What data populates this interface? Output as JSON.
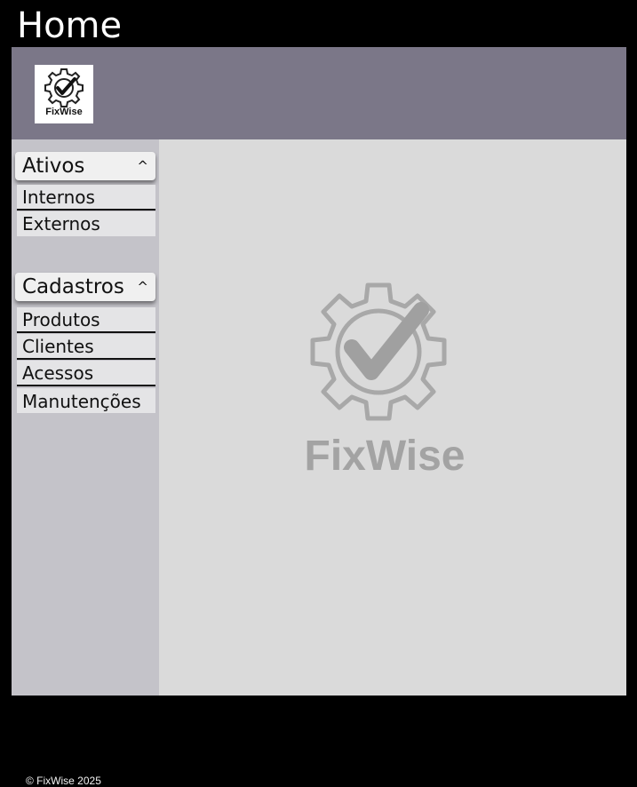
{
  "window": {
    "title": "Home"
  },
  "header": {
    "logo_text": "FixWise",
    "logo_icon": "gear-check-icon"
  },
  "sidebar": {
    "sections": [
      {
        "label": "Ativos",
        "caret": "^",
        "items": [
          {
            "label": "Internos"
          },
          {
            "label": "Externos"
          }
        ]
      },
      {
        "label": "Cadastros",
        "caret": "^",
        "items": [
          {
            "label": "Produtos"
          },
          {
            "label": "Clientes"
          },
          {
            "label": "Acessos"
          },
          {
            "label": "Manutenções"
          }
        ]
      }
    ],
    "footer": "© FixWise 2025"
  },
  "main": {
    "watermark_text": "FixWise",
    "watermark_icon": "gear-check-icon"
  },
  "colors": {
    "header_bg": "#7b7788",
    "sidebar_bg": "#c4c3c9",
    "main_bg": "#dadada",
    "watermark": "#a3a3a3"
  }
}
